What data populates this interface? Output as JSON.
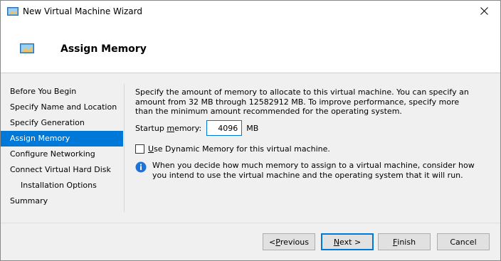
{
  "window": {
    "title": "New Virtual Machine Wizard"
  },
  "header": {
    "title": "Assign Memory"
  },
  "nav": {
    "items": [
      {
        "label": "Before You Begin"
      },
      {
        "label": "Specify Name and Location"
      },
      {
        "label": "Specify Generation"
      },
      {
        "label": "Assign Memory"
      },
      {
        "label": "Configure Networking"
      },
      {
        "label": "Connect Virtual Hard Disk"
      },
      {
        "label": "Installation Options"
      },
      {
        "label": "Summary"
      }
    ]
  },
  "content": {
    "description": "Specify the amount of memory to allocate to this virtual machine. You can specify an amount from 32 MB through 12582912 MB. To improve performance, specify more than the minimum amount recommended for the operating system.",
    "startup_memory_label_pre": "Startup ",
    "startup_memory_label_accel": "m",
    "startup_memory_label_post": "emory:",
    "startup_memory_value": "4096",
    "startup_memory_unit": "MB",
    "dynamic_memory_accel": "U",
    "dynamic_memory_label_post": "se Dynamic Memory for this virtual machine.",
    "dynamic_memory_checked": false,
    "info_text": "When you decide how much memory to assign to a virtual machine, consider how you intend to use the virtual machine and the operating system that it will run."
  },
  "buttons": {
    "previous_pre": "< ",
    "previous_accel": "P",
    "previous_post": "revious",
    "next_accel": "N",
    "next_post": "ext >",
    "finish_accel": "F",
    "finish_post": "inish",
    "cancel": "Cancel"
  },
  "colors": {
    "accent": "#0078d7",
    "selection_text": "#ffffff",
    "info_icon": "#1e73d8"
  },
  "icons": {
    "title": "vm-monitor-icon",
    "header": "vm-monitor-icon",
    "close": "close-icon",
    "info": "info-icon"
  }
}
